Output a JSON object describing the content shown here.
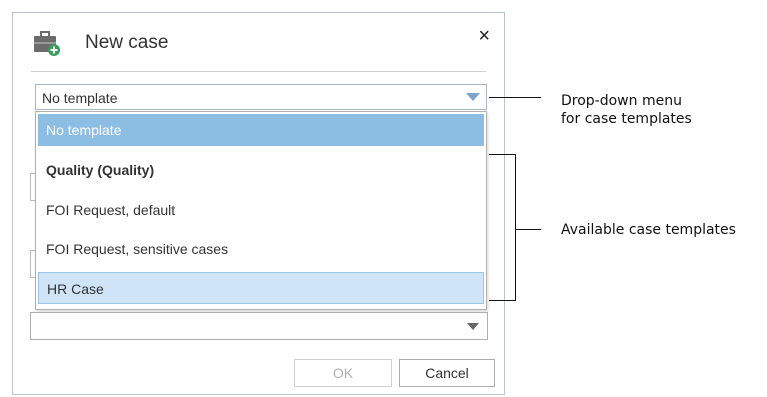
{
  "dialog": {
    "title": "New case",
    "close_glyph": "×",
    "icon": "briefcase-add-icon"
  },
  "template_select": {
    "value": "No template"
  },
  "dropdown": {
    "options": [
      {
        "label": "No template",
        "state": "selected",
        "bold": false
      },
      {
        "label": "Quality (Quality)",
        "state": "normal",
        "bold": true
      },
      {
        "label": "FOI Request, default",
        "state": "normal",
        "bold": false
      },
      {
        "label": "FOI Request, sensitive cases",
        "state": "normal",
        "bold": false
      },
      {
        "label": "HR Case",
        "state": "hover",
        "bold": false
      }
    ]
  },
  "buttons": {
    "ok": "OK",
    "cancel": "Cancel"
  },
  "callouts": {
    "dropdown_menu_line1": "Drop-down menu",
    "dropdown_menu_line2": "for case templates",
    "available_templates": "Available case templates"
  },
  "colors": {
    "selected_bg": "#8cbde2",
    "hover_bg": "#cfe4f6",
    "accent_arrow": "#7ba4c7"
  }
}
